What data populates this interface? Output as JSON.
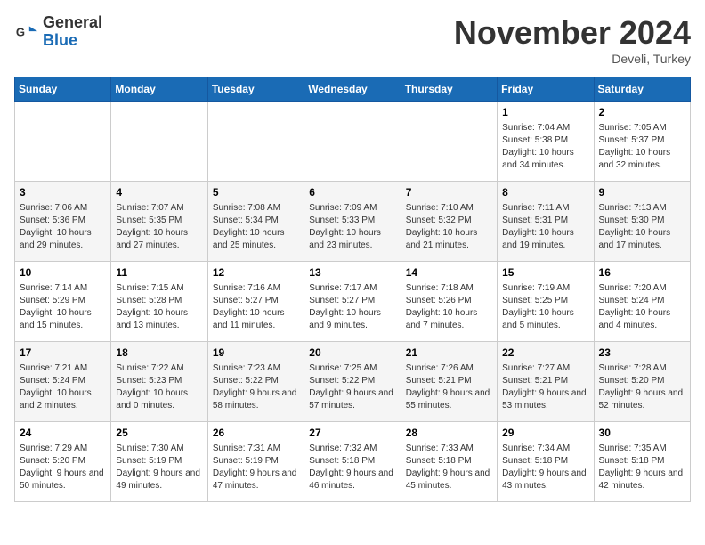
{
  "header": {
    "logo_general": "General",
    "logo_blue": "Blue",
    "month_title": "November 2024",
    "location": "Develi, Turkey"
  },
  "weekdays": [
    "Sunday",
    "Monday",
    "Tuesday",
    "Wednesday",
    "Thursday",
    "Friday",
    "Saturday"
  ],
  "weeks": [
    [
      {
        "day": "",
        "info": ""
      },
      {
        "day": "",
        "info": ""
      },
      {
        "day": "",
        "info": ""
      },
      {
        "day": "",
        "info": ""
      },
      {
        "day": "",
        "info": ""
      },
      {
        "day": "1",
        "info": "Sunrise: 7:04 AM\nSunset: 5:38 PM\nDaylight: 10 hours and 34 minutes."
      },
      {
        "day": "2",
        "info": "Sunrise: 7:05 AM\nSunset: 5:37 PM\nDaylight: 10 hours and 32 minutes."
      }
    ],
    [
      {
        "day": "3",
        "info": "Sunrise: 7:06 AM\nSunset: 5:36 PM\nDaylight: 10 hours and 29 minutes."
      },
      {
        "day": "4",
        "info": "Sunrise: 7:07 AM\nSunset: 5:35 PM\nDaylight: 10 hours and 27 minutes."
      },
      {
        "day": "5",
        "info": "Sunrise: 7:08 AM\nSunset: 5:34 PM\nDaylight: 10 hours and 25 minutes."
      },
      {
        "day": "6",
        "info": "Sunrise: 7:09 AM\nSunset: 5:33 PM\nDaylight: 10 hours and 23 minutes."
      },
      {
        "day": "7",
        "info": "Sunrise: 7:10 AM\nSunset: 5:32 PM\nDaylight: 10 hours and 21 minutes."
      },
      {
        "day": "8",
        "info": "Sunrise: 7:11 AM\nSunset: 5:31 PM\nDaylight: 10 hours and 19 minutes."
      },
      {
        "day": "9",
        "info": "Sunrise: 7:13 AM\nSunset: 5:30 PM\nDaylight: 10 hours and 17 minutes."
      }
    ],
    [
      {
        "day": "10",
        "info": "Sunrise: 7:14 AM\nSunset: 5:29 PM\nDaylight: 10 hours and 15 minutes."
      },
      {
        "day": "11",
        "info": "Sunrise: 7:15 AM\nSunset: 5:28 PM\nDaylight: 10 hours and 13 minutes."
      },
      {
        "day": "12",
        "info": "Sunrise: 7:16 AM\nSunset: 5:27 PM\nDaylight: 10 hours and 11 minutes."
      },
      {
        "day": "13",
        "info": "Sunrise: 7:17 AM\nSunset: 5:27 PM\nDaylight: 10 hours and 9 minutes."
      },
      {
        "day": "14",
        "info": "Sunrise: 7:18 AM\nSunset: 5:26 PM\nDaylight: 10 hours and 7 minutes."
      },
      {
        "day": "15",
        "info": "Sunrise: 7:19 AM\nSunset: 5:25 PM\nDaylight: 10 hours and 5 minutes."
      },
      {
        "day": "16",
        "info": "Sunrise: 7:20 AM\nSunset: 5:24 PM\nDaylight: 10 hours and 4 minutes."
      }
    ],
    [
      {
        "day": "17",
        "info": "Sunrise: 7:21 AM\nSunset: 5:24 PM\nDaylight: 10 hours and 2 minutes."
      },
      {
        "day": "18",
        "info": "Sunrise: 7:22 AM\nSunset: 5:23 PM\nDaylight: 10 hours and 0 minutes."
      },
      {
        "day": "19",
        "info": "Sunrise: 7:23 AM\nSunset: 5:22 PM\nDaylight: 9 hours and 58 minutes."
      },
      {
        "day": "20",
        "info": "Sunrise: 7:25 AM\nSunset: 5:22 PM\nDaylight: 9 hours and 57 minutes."
      },
      {
        "day": "21",
        "info": "Sunrise: 7:26 AM\nSunset: 5:21 PM\nDaylight: 9 hours and 55 minutes."
      },
      {
        "day": "22",
        "info": "Sunrise: 7:27 AM\nSunset: 5:21 PM\nDaylight: 9 hours and 53 minutes."
      },
      {
        "day": "23",
        "info": "Sunrise: 7:28 AM\nSunset: 5:20 PM\nDaylight: 9 hours and 52 minutes."
      }
    ],
    [
      {
        "day": "24",
        "info": "Sunrise: 7:29 AM\nSunset: 5:20 PM\nDaylight: 9 hours and 50 minutes."
      },
      {
        "day": "25",
        "info": "Sunrise: 7:30 AM\nSunset: 5:19 PM\nDaylight: 9 hours and 49 minutes."
      },
      {
        "day": "26",
        "info": "Sunrise: 7:31 AM\nSunset: 5:19 PM\nDaylight: 9 hours and 47 minutes."
      },
      {
        "day": "27",
        "info": "Sunrise: 7:32 AM\nSunset: 5:18 PM\nDaylight: 9 hours and 46 minutes."
      },
      {
        "day": "28",
        "info": "Sunrise: 7:33 AM\nSunset: 5:18 PM\nDaylight: 9 hours and 45 minutes."
      },
      {
        "day": "29",
        "info": "Sunrise: 7:34 AM\nSunset: 5:18 PM\nDaylight: 9 hours and 43 minutes."
      },
      {
        "day": "30",
        "info": "Sunrise: 7:35 AM\nSunset: 5:18 PM\nDaylight: 9 hours and 42 minutes."
      }
    ]
  ]
}
